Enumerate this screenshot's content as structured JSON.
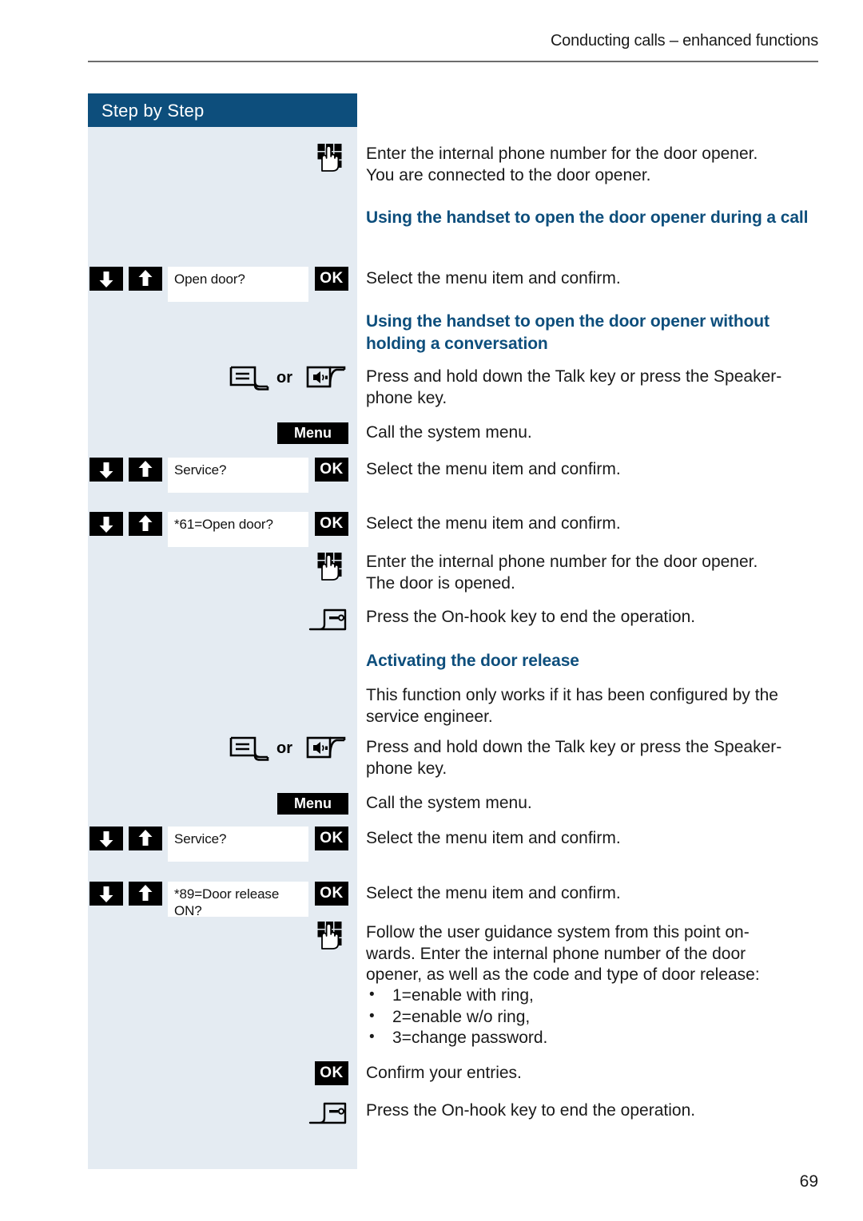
{
  "page": {
    "running_head": "Conducting calls – enhanced functions",
    "page_number": "69",
    "sidebar_title": "Step by Step",
    "accent_color": "#0d4e7c",
    "sidebar_bg": "#e4ebf2"
  },
  "steps": {
    "s1": {
      "icon": "keypad-icon",
      "text_line1": "Enter the internal phone number for the door opener.",
      "text_line2": "You are connected to the door opener."
    },
    "h1": "Using the handset to open the door opener during a call",
    "s2": {
      "down_icon": "arrow-down-icon",
      "up_icon": "arrow-up-icon",
      "display": "Open door?",
      "ok_label": "OK",
      "text": "Select the menu item and confirm."
    },
    "h2": "Using the handset to open the door opener without holding a conversation",
    "s3": {
      "talk_icon": "talk-key-icon",
      "or_label": "or",
      "speaker_icon": "speakerphone-key-icon",
      "text_line1": "Press and hold down the Talk key or press the Speaker-",
      "text_line2": "phone key."
    },
    "s4": {
      "menu_label": "Menu",
      "text": "Call the system menu."
    },
    "s5": {
      "display": "Service?",
      "ok_label": "OK",
      "text": "Select the menu item and confirm."
    },
    "s6": {
      "display": "*61=Open door?",
      "ok_label": "OK",
      "text": "Select the menu item and confirm."
    },
    "s7": {
      "icon": "keypad-icon",
      "text_line1": "Enter the internal phone number for the door opener.",
      "text_line2": "The door is opened."
    },
    "s8": {
      "icon": "on-hook-key-icon",
      "text": "Press the On-hook key to end the operation."
    },
    "h3": "Activating the door release",
    "s9": {
      "text_line1": "This function only works if it has been configured by the",
      "text_line2": "service engineer."
    },
    "s10": {
      "talk_icon": "talk-key-icon",
      "or_label": "or",
      "speaker_icon": "speakerphone-key-icon",
      "text_line1": "Press and hold down the Talk key or press the Speaker-",
      "text_line2": "phone key."
    },
    "s11": {
      "menu_label": "Menu",
      "text": "Call the system menu."
    },
    "s12": {
      "display": "Service?",
      "ok_label": "OK",
      "text": "Select the menu item and confirm."
    },
    "s13": {
      "display_line1": "*89=Door release",
      "display_line2": "ON?",
      "ok_label": "OK",
      "text": "Select the menu item and confirm."
    },
    "s14": {
      "icon": "keypad-icon",
      "text_line1": "Follow the user guidance system from this point on-",
      "text_line2": "wards. Enter the internal phone number of the door",
      "text_line3": "opener, as well as the code and type of door release:",
      "bullets": [
        "1=enable with ring,",
        "2=enable w/o ring,",
        "3=change password."
      ]
    },
    "s15": {
      "ok_label": "OK",
      "text": "Confirm your entries."
    },
    "s16": {
      "icon": "on-hook-key-icon",
      "text": "Press the On-hook key to end the operation."
    }
  }
}
